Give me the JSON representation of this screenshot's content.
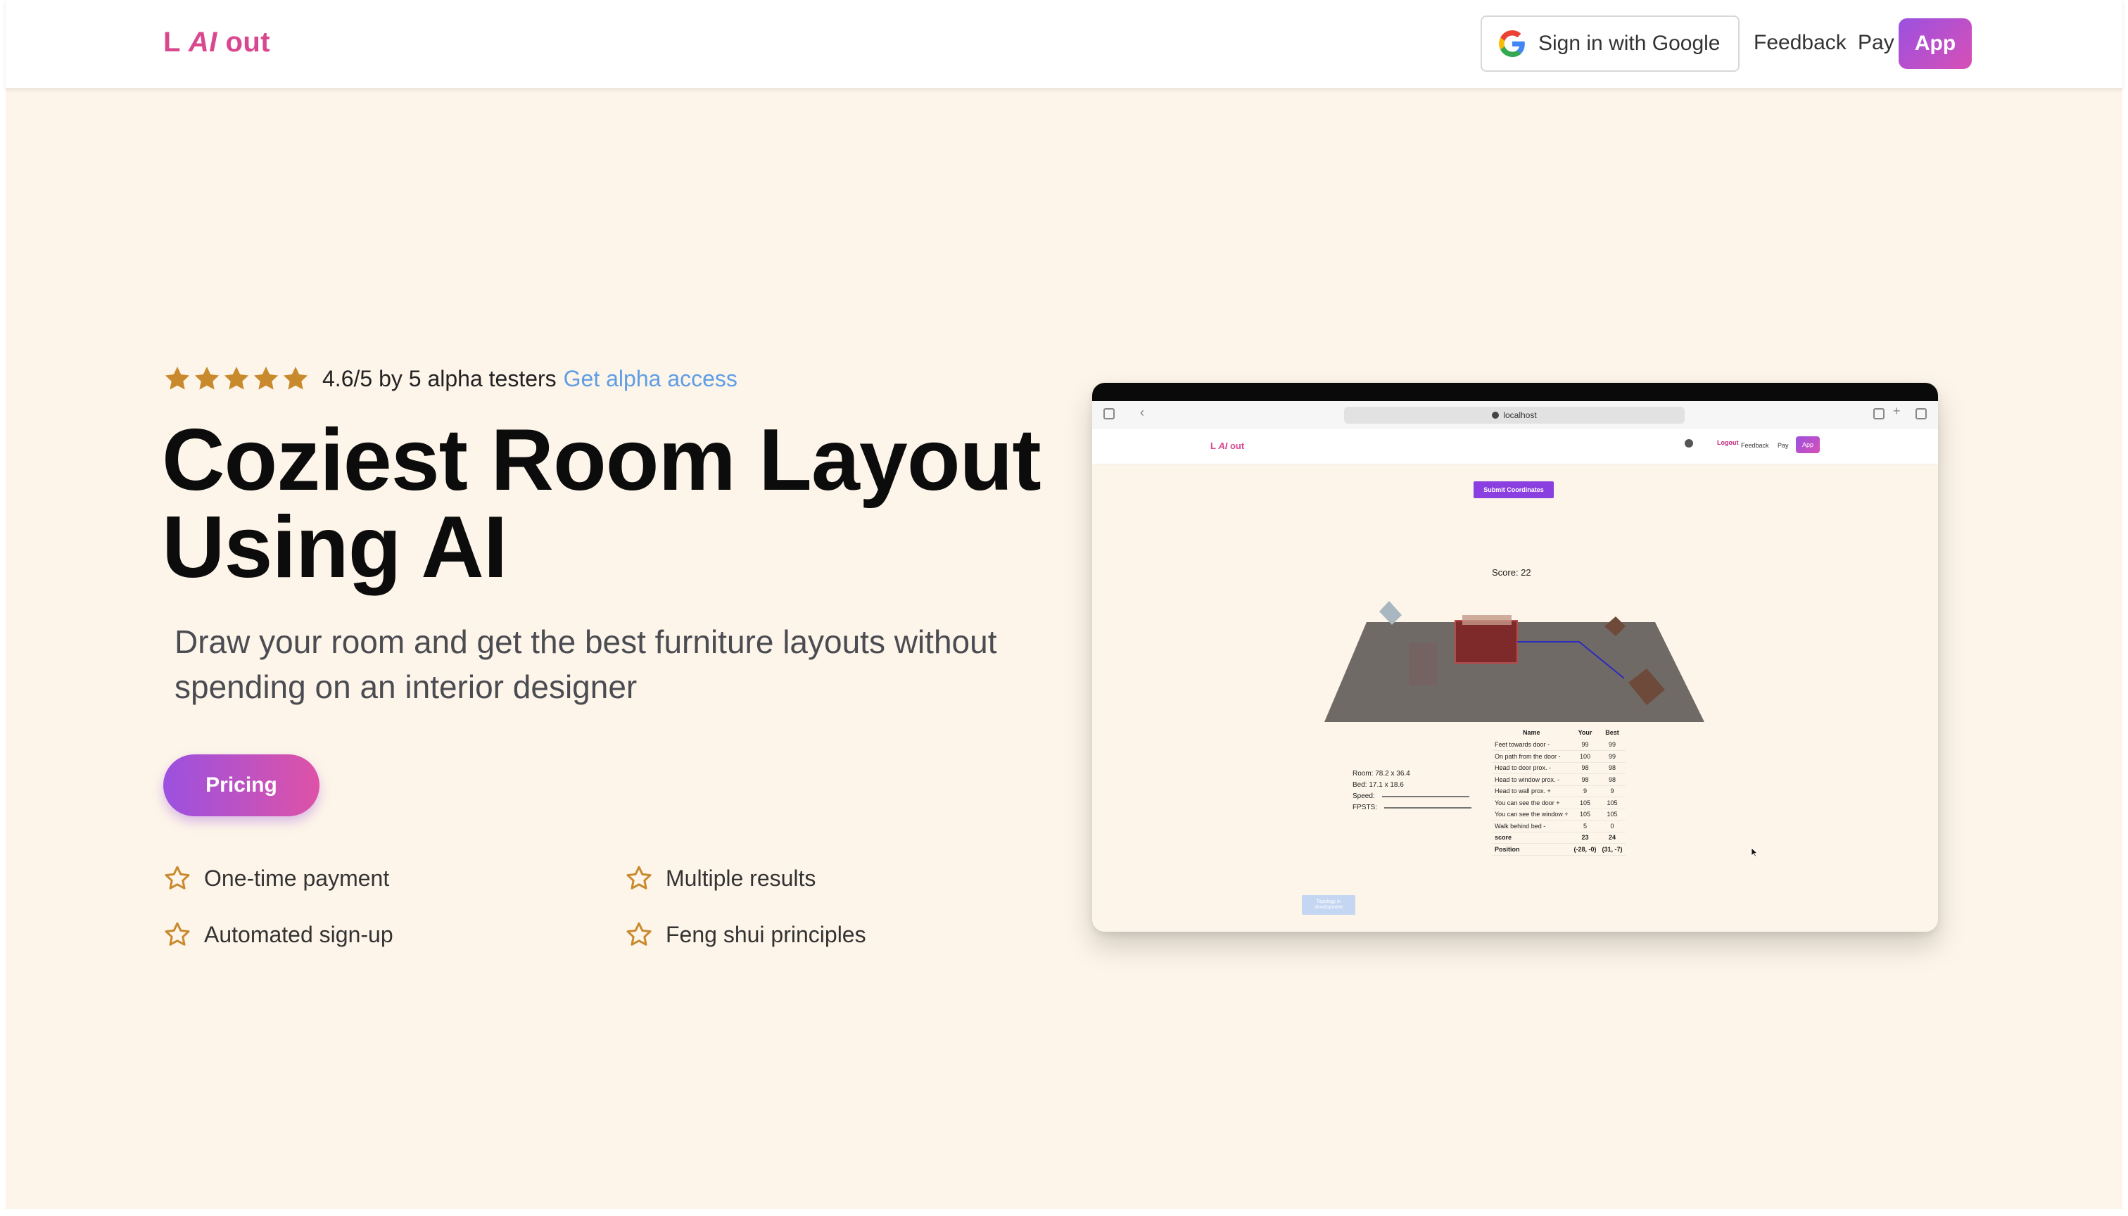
{
  "header": {
    "logo_prefix": "L ",
    "logo_ai": "AI",
    "logo_suffix": " out",
    "google_signin_label": "Sign in with Google",
    "feedback_label": "Feedback",
    "pay_label": "Pay",
    "app_label": "App"
  },
  "hero": {
    "rating_text": "4.6/5 by 5 alpha testers",
    "rating_link": "Get alpha access",
    "star_count": 5,
    "title": "Coziest Room Layout Using AI",
    "subtitle": "Draw your room and get the best furniture layouts without spending on an interior designer",
    "cta_label": "Pricing",
    "features": [
      "One-time payment",
      "Multiple results",
      "Automated sign-up",
      "Feng shui principles"
    ]
  },
  "preview": {
    "url": "localhost",
    "logo_prefix": "L ",
    "logo_ai": "AI",
    "logo_suffix": " out",
    "logout_label": "Logout",
    "feedback_label": "Feedback",
    "pay_label": "Pay",
    "app_label": "App",
    "submit_label": "Submit Coordinates",
    "score_label": "Score: 22",
    "room_label": "Room: 78.2 x 36.4",
    "bed_label": "Bed: 17.1 x 18.6",
    "speed_label": "Speed:",
    "fpsts_label": "FPSTS:",
    "table": {
      "headers": [
        "Name",
        "Your",
        "Best"
      ],
      "rows": [
        [
          "Feet towards door -",
          "99",
          "99"
        ],
        [
          "On path from the door -",
          "100",
          "99"
        ],
        [
          "Head to door prox. -",
          "98",
          "98"
        ],
        [
          "Head to window prox. -",
          "98",
          "98"
        ],
        [
          "Head to wall prox. +",
          "9",
          "9"
        ],
        [
          "You can see the door +",
          "105",
          "105"
        ],
        [
          "You can see the window +",
          "105",
          "105"
        ],
        [
          "Walk behind bed -",
          "5",
          "0"
        ],
        [
          "score",
          "23",
          "24"
        ],
        [
          "Position",
          "(-28, -0)",
          "(31, -7)"
        ]
      ]
    },
    "disabled_button_label": "Topology in development"
  },
  "colors": {
    "brand_pink": "#d9488f",
    "brand_purple": "#9b51e0",
    "background_cream": "#fdf5e9",
    "star_gold": "#c98a2e",
    "link_blue": "#5f9de6"
  }
}
